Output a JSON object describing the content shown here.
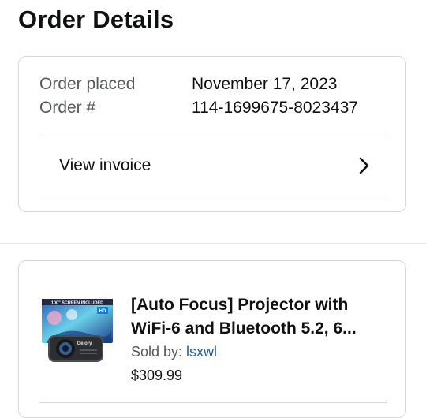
{
  "header": {
    "title": "Order Details"
  },
  "order_summary": {
    "placed_label": "Order placed",
    "placed_value": "November 17, 2023",
    "number_label": "Order #",
    "number_value": "114-1699675-8023437",
    "invoice_label": "View invoice",
    "invoice_icon": "chevron-right-icon"
  },
  "item": {
    "title_line1": "[Auto Focus] Projector with",
    "title_line2": "WiFi-6 and Bluetooth 5.2, 6...",
    "sold_by_label": "Sold by: ",
    "seller": "lsxwl",
    "price": "$309.99",
    "image_icon": "projector-product-image",
    "image_text_banner": "100\" SCREEN INCLUDED",
    "image_text_hd": "HD",
    "image_text_brand": "Gelory"
  },
  "colors": {
    "text": "#0f1111",
    "secondary_text": "#565959",
    "link": "#2162a1",
    "border": "#d5d9d9"
  }
}
